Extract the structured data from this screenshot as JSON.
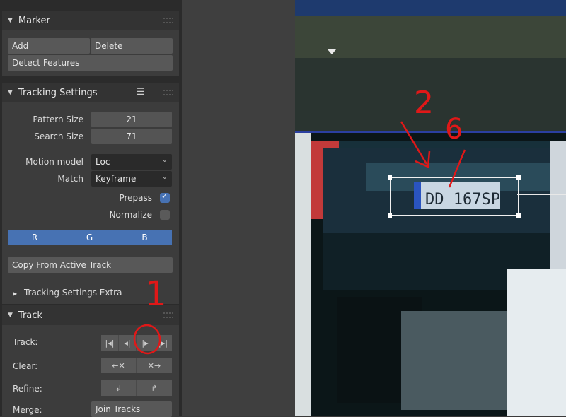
{
  "marker": {
    "title": "Marker",
    "add": "Add",
    "delete": "Delete",
    "detect": "Detect Features"
  },
  "tracking_settings": {
    "title": "Tracking Settings",
    "pattern_size_label": "Pattern Size",
    "pattern_size_value": "21",
    "search_size_label": "Search Size",
    "search_size_value": "71",
    "motion_model_label": "Motion model",
    "motion_model_value": "Loc",
    "match_label": "Match",
    "match_value": "Keyframe",
    "prepass_label": "Prepass",
    "prepass_checked": true,
    "normalize_label": "Normalize",
    "normalize_checked": false,
    "channels": [
      "R",
      "G",
      "B"
    ],
    "copy_button": "Copy From Active Track",
    "extra_title": "Tracking Settings Extra"
  },
  "track": {
    "title": "Track",
    "track_label": "Track:",
    "clear_label": "Clear:",
    "refine_label": "Refine:",
    "merge_label": "Merge:",
    "join_button": "Join Tracks"
  },
  "viewport": {
    "plate_text": "DD 167SP"
  },
  "annotations": {
    "one": "1",
    "two": "2",
    "six": "6"
  },
  "colors": {
    "accent": "#4772b3",
    "annotation": "#e01818"
  }
}
